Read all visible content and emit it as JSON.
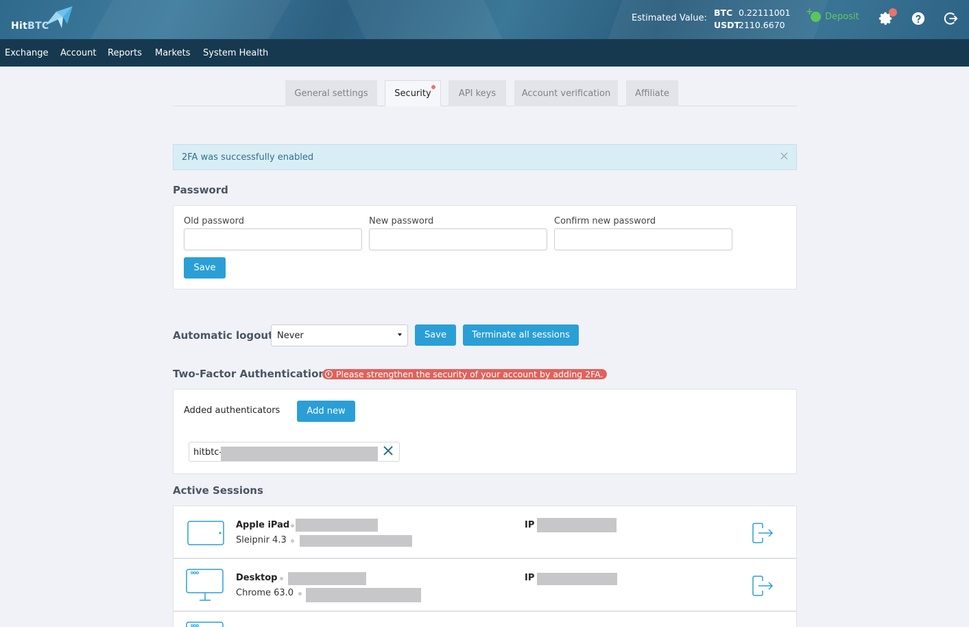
{
  "header": {
    "logo_text_hit": "Hit",
    "logo_text_btc": "BTC",
    "estimated_label": "Estimated Value:",
    "balances": [
      {
        "currency": "BTC",
        "amount": "0.22111001"
      },
      {
        "currency": "USDT",
        "amount": "2110.6670"
      }
    ],
    "deposit_label": "Deposit",
    "icons": [
      "gear-icon",
      "help-icon",
      "logout-icon"
    ]
  },
  "nav": [
    "Exchange",
    "Account",
    "Reports",
    "Markets",
    "System Health"
  ],
  "tabs": [
    {
      "label": "General settings",
      "active": false
    },
    {
      "label": "Security",
      "active": true,
      "notify": true
    },
    {
      "label": "API keys",
      "active": false
    },
    {
      "label": "Account verification",
      "active": false
    },
    {
      "label": "Affiliate",
      "active": false
    }
  ],
  "alert": {
    "text": "2FA was successfully enabled",
    "close": "×"
  },
  "password": {
    "title": "Password",
    "old_label": "Old password",
    "new_label": "New password",
    "confirm_label": "Confirm new password",
    "old_value": "",
    "new_value": "",
    "confirm_value": "",
    "save": "Save"
  },
  "autologout": {
    "label": "Automatic logout",
    "selected": "Never",
    "save": "Save",
    "terminate": "Terminate all sessions"
  },
  "twofa": {
    "title": "Two-Factor Authentication",
    "warning": "Please strengthen the security of your account by adding 2FA.",
    "added_label": "Added authenticators",
    "add_new": "Add new",
    "authenticator_prefix": "hitbtc-"
  },
  "sessions": {
    "title": "Active Sessions",
    "ip_label": "IP",
    "items": [
      {
        "device": "Apple iPad",
        "browser": "Sleipnir 4.3",
        "device_icon": "tablet-icon"
      },
      {
        "device": "Desktop",
        "browser": "Chrome 63.0",
        "device_icon": "monitor-icon"
      }
    ]
  },
  "colors": {
    "accent": "#2a9fd6",
    "header_nav": "#17394f",
    "deposit": "#5cc55a",
    "warning": "#e0625c"
  }
}
